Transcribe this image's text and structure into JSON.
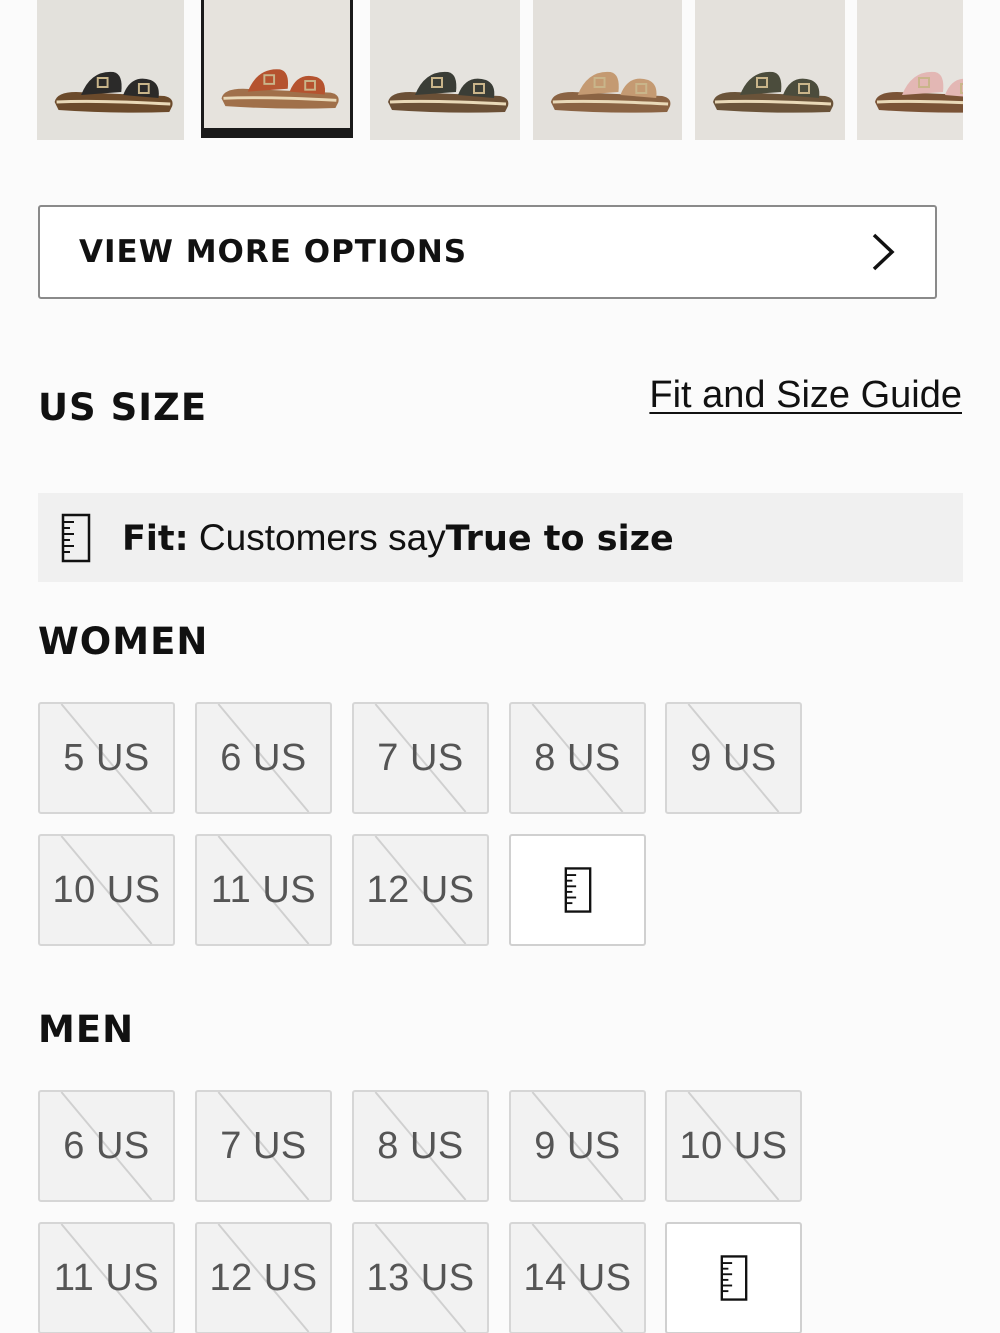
{
  "colors": {
    "text": "#111111",
    "banner_bg": "#f0f0f0",
    "unavailable_bg": "#f2f2f2"
  },
  "thumbnails": [
    {
      "name": "black",
      "color": "#2b2a29",
      "sole": "#6b4a2b",
      "bg": "#e3e1dc",
      "selected": false
    },
    {
      "name": "tan-red",
      "color": "#b5532f",
      "sole": "#a0704a",
      "bg": "#e6e3dd",
      "selected": true
    },
    {
      "name": "dark-olive",
      "color": "#3a3d36",
      "sole": "#6b5036",
      "bg": "#e5e3de",
      "selected": false
    },
    {
      "name": "sand",
      "color": "#c49a72",
      "sole": "#8a6343",
      "bg": "#e3e0db",
      "selected": false
    },
    {
      "name": "olive",
      "color": "#4b4c3c",
      "sole": "#6a5339",
      "bg": "#e4e1dc",
      "selected": false
    },
    {
      "name": "pink",
      "color": "#e3b7b4",
      "sole": "#7a5336",
      "bg": "#e6e3de",
      "selected": false
    }
  ],
  "view_more": {
    "label": "VIEW MORE OPTIONS",
    "icon": "chevron-right-icon"
  },
  "size": {
    "title": "US SIZE",
    "guide_link": "Fit and Size Guide",
    "fit_label": "Fit:",
    "fit_text": "Customers say",
    "fit_value": "True to size",
    "fit_icon": "ruler-icon"
  },
  "women": {
    "title": "WOMEN",
    "sizes": [
      "5 US",
      "6 US",
      "7 US",
      "8 US",
      "9 US",
      "10 US",
      "11 US",
      "12 US"
    ],
    "guide_icon": "ruler-icon"
  },
  "men": {
    "title": "MEN",
    "sizes": [
      "6 US",
      "7 US",
      "8 US",
      "9 US",
      "10 US",
      "11 US",
      "12 US",
      "13 US",
      "14 US"
    ],
    "guide_icon": "ruler-icon"
  }
}
